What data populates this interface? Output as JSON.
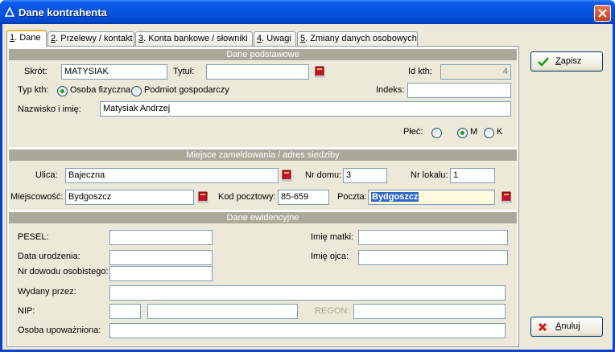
{
  "window": {
    "title": "Dane kontrahenta"
  },
  "tabs": [
    {
      "num": "1",
      "label": ". Dane"
    },
    {
      "num": "2",
      "label": ". Przelewy / kontakt"
    },
    {
      "num": "3",
      "label": ". Konta bankowe / słowniki"
    },
    {
      "num": "4",
      "label": ". Uwagi"
    },
    {
      "num": "5",
      "label": ". Zmiany danych osobowych"
    }
  ],
  "sections": {
    "basic": "Dane podstawowe",
    "address": "Miejsce zameldowania / adres siedziby",
    "records": "Dane ewidencyjne"
  },
  "basic": {
    "short_label": "Skrót:",
    "short_value": "MATYSIAK",
    "title_label": "Tytuł:",
    "title_value": "",
    "id_label": "Id kth:",
    "id_value": "4",
    "type_label": "Typ kth:",
    "type_person": "Osoba fizyczna",
    "type_company": "Podmiot gospodarczy",
    "index_label": "Indeks:",
    "index_value": "",
    "name_label": "Nazwisko i imię:",
    "name_value": "Matysiak Andrzej",
    "gender_label": "Płeć:",
    "gender_m": "M",
    "gender_k": "K"
  },
  "address": {
    "street_label": "Ulica:",
    "street_value": "Bajeczna",
    "house_label": "Nr domu:",
    "house_value": "3",
    "flat_label": "Nr lokalu:",
    "flat_value": "1",
    "city_label": "Miejscowość:",
    "city_value": "Bydgoszcz",
    "zip_label": "Kod pocztowy:",
    "zip_value": "85-659",
    "post_label": "Poczta:",
    "post_value": "Bydgoszcz"
  },
  "records": {
    "pesel_label": "PESEL:",
    "mother_label": "Imię matki:",
    "birth_label": "Data urodzenia:",
    "father_label": "Imię ojca:",
    "id_doc_label": "Nr dowodu osobistego:",
    "issued_label": "Wydany przez:",
    "nip_label": "NIP:",
    "regon_label": "REGON:",
    "authorized_label": "Osoba upoważniona:"
  },
  "buttons": {
    "save_mnemonic": "Z",
    "save_rest": "apisz",
    "cancel_mnemonic": "A",
    "cancel_rest": "nuluj"
  },
  "colors": {
    "title_bar": "#0654e0",
    "section_band": "#aca899",
    "selection": "#316ac5"
  }
}
